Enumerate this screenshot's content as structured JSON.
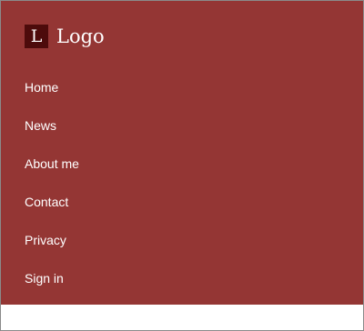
{
  "logo": {
    "mark": "L",
    "text": "Logo",
    "colors": {
      "panel": "#943634",
      "mark_background": "#4d0b0b",
      "text": "#ffffff"
    }
  },
  "navigation": {
    "items": [
      {
        "label": "Home"
      },
      {
        "label": "News"
      },
      {
        "label": "About me"
      },
      {
        "label": "Contact"
      },
      {
        "label": "Privacy"
      },
      {
        "label": "Sign in"
      }
    ]
  }
}
